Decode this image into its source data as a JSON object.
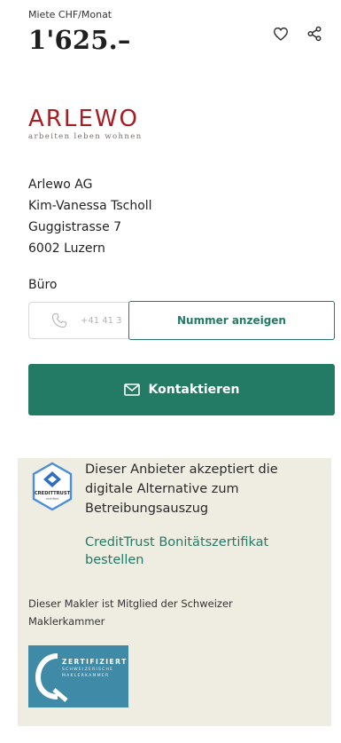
{
  "listing": {
    "price_label": "Miete CHF/Monat",
    "price_value": "1'625.–",
    "favorite_icon": "heart-icon",
    "share_icon": "share-icon"
  },
  "agency": {
    "logo_word": "ARLEWO",
    "logo_tagline": "arbeiten leben wohnen",
    "logo_color": "#a61e22",
    "address": {
      "company": "Arlewo AG",
      "contact_person": "Kim-Vanessa Tscholl",
      "street": "Guggistrasse 7",
      "city": "6002 Luzern"
    },
    "office_label": "Büro",
    "phone_partial": "+41 41 3",
    "phone_icon": "phone-icon"
  },
  "actions": {
    "show_number_label": "Nummer anzeigen",
    "contact_label": "Kontaktieren",
    "contact_icon": "mail-icon"
  },
  "credittrust": {
    "badge_text": "CREDITTRUST",
    "badge_subtext": "certified",
    "description": "Dieser Anbieter akzeptiert die digitale Alternative zum Betreibungsauszug",
    "link_label": "CreditTrust Bonitätszertifikat bestellen"
  },
  "maklerkammer": {
    "description": "Dieser Makler ist Mitglied der Schweizer Maklerkammer",
    "badge_title": "ZERTIFIZIERT",
    "badge_line1": "SCHWEIZERISCHE",
    "badge_line2": "MAKLERKAMMER"
  },
  "colors": {
    "accent_green": "#237a65",
    "info_box_bg": "#efece2",
    "makler_badge_bg": "#3f8aa6"
  }
}
